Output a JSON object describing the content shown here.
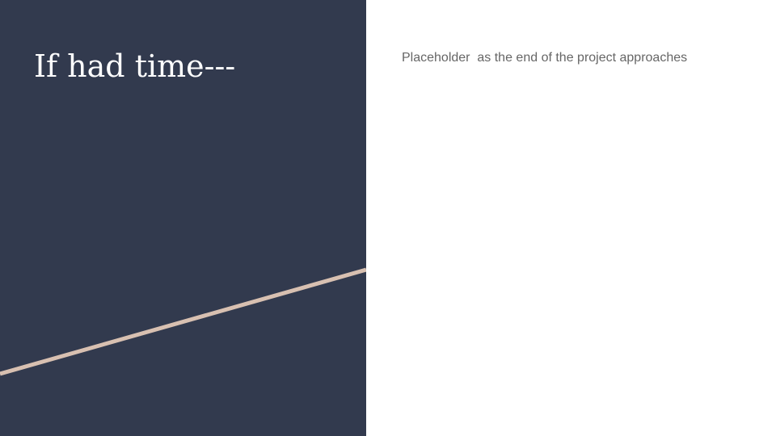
{
  "slide": {
    "title": "If had time---",
    "body_text": "Placeholder  as the end of the project approaches"
  },
  "colors": {
    "left_panel": "#323a4e",
    "accent_line": "#d8c0b1",
    "title_text": "#ffffff",
    "body_text": "#666666",
    "background": "#ffffff"
  }
}
